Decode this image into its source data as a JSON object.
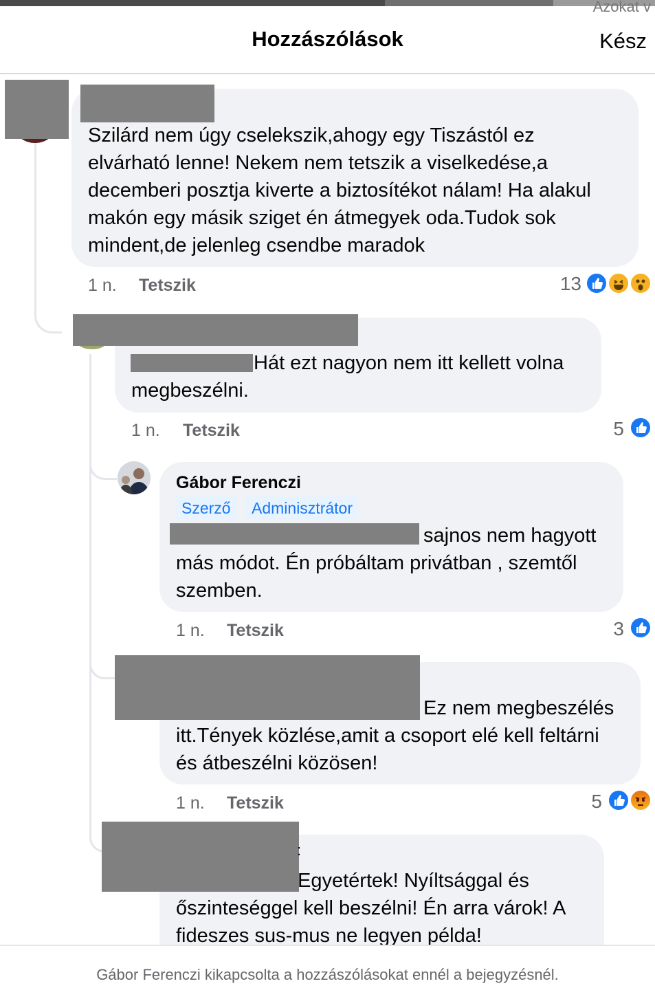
{
  "header": {
    "title": "Hozzászólások",
    "done_label": "Kész",
    "peek_text": "Azokat v"
  },
  "comments": [
    {
      "text": "Szilárd nem úgy cselekszik,ahogy egy Tiszástól ez elvárható lenne! Nekem nem tetszik a viselkedése,a decemberi posztja kiverte a biztosítékot nálam! Ha alakul makón egy másik sziget én átmegyek oda.Tudok sok mindent,de jelenleg csendbe maradok",
      "lines": [
        "Szilárd nem úgy cselekszik,ahogy egy Tiszástól ez",
        "elvárható lenne! Nekem nem tetszik a viselkedése,a",
        "decemberi posztja kiverte a biztosítékot nálam! Ha alakul",
        "makón egy másik sziget én átmegyek oda.Tudok sok",
        "mindent,de jelenleg csendbe maradok"
      ],
      "time": "1 n.",
      "like_label": "Tetszik",
      "reaction_count": "13",
      "reactions": [
        "like-icon",
        "haha-icon",
        "wow-icon"
      ]
    },
    {
      "lines": [
        "Hát ezt nagyon nem itt kellett volna",
        "megbeszélni."
      ],
      "time": "1 n.",
      "like_label": "Tetszik",
      "reaction_count": "5",
      "reactions": [
        "like-icon"
      ]
    },
    {
      "author": "Gábor Ferenczi",
      "badges": [
        "Szerző",
        "Adminisztrátor"
      ],
      "lines": [
        "sajnos nem hagyott",
        "más módot. Én próbáltam privátban , szemtől",
        "szemben."
      ],
      "time": "1 n.",
      "like_label": "Tetszik",
      "reaction_count": "3",
      "reactions": [
        "like-icon"
      ]
    },
    {
      "lines": [
        "Ez nem megbeszélés",
        "itt.Tények közlése,amit a csoport elé kell feltárni",
        "és átbeszélni közösen!"
      ],
      "time": "1 n.",
      "like_label": "Tetszik",
      "reaction_count": "5",
      "reactions": [
        "like-icon",
        "angry-icon"
      ]
    },
    {
      "lines_prefix": ":",
      "lines": [
        "Egyetértek! Nyíltsággal és",
        "őszinteséggel kell beszélni! Én arra várok! A",
        "fideszes sus-mus ne legyen példa!"
      ]
    }
  ],
  "footer": {
    "note": "Gábor Ferenczi kikapcsolta a hozzászólásokat ennél a bejegyzésnél."
  },
  "colors": {
    "bubble": "#f0f2f5",
    "accent": "#1877f2",
    "muted": "#65676b",
    "redaction": "#808080"
  }
}
